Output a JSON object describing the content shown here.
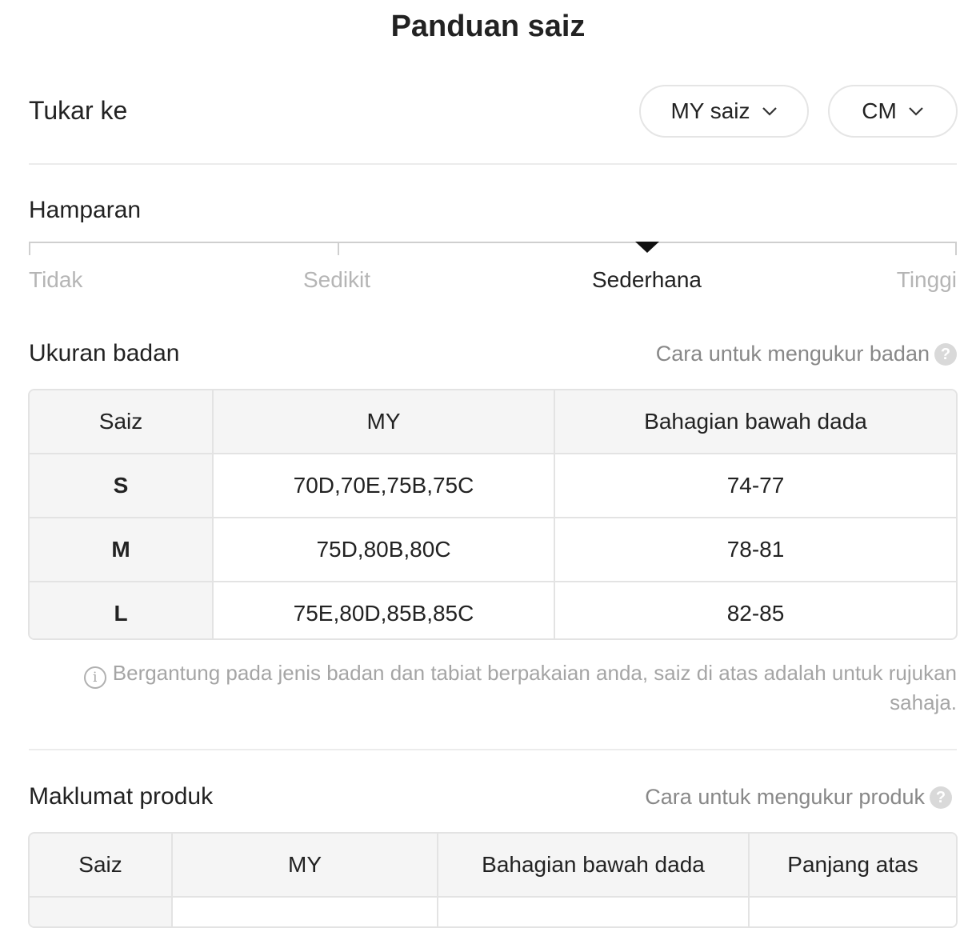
{
  "header": {
    "title": "Panduan saiz"
  },
  "switch": {
    "label": "Tukar ke",
    "region_select": "MY saiz",
    "unit_select": "CM",
    "chevron_icon": "chevron-down-icon"
  },
  "stretch": {
    "title": "Hamparan",
    "options": [
      "Tidak",
      "Sedikit",
      "Sederhana",
      "Tinggi"
    ],
    "selected": "Sederhana"
  },
  "body_size": {
    "title": "Ukuran badan",
    "help_link": "Cara untuk mengukur badan",
    "help_icon": "?",
    "columns": [
      "Saiz",
      "MY",
      "Bahagian bawah dada"
    ],
    "rows": [
      [
        "S",
        "70D,70E,75B,75C",
        "74-77"
      ],
      [
        "M",
        "75D,80B,80C",
        "78-81"
      ],
      [
        "L",
        "75E,80D,85B,85C",
        "82-85"
      ]
    ],
    "note_icon": "info-icon",
    "note": "Bergantung pada jenis badan dan tabiat berpakaian anda, saiz di atas adalah untuk rujukan sahaja."
  },
  "product_info": {
    "title": "Maklumat produk",
    "help_link": "Cara untuk mengukur produk",
    "help_icon": "?",
    "columns": [
      "Saiz",
      "MY",
      "Bahagian bawah dada",
      "Panjang atas"
    ]
  }
}
